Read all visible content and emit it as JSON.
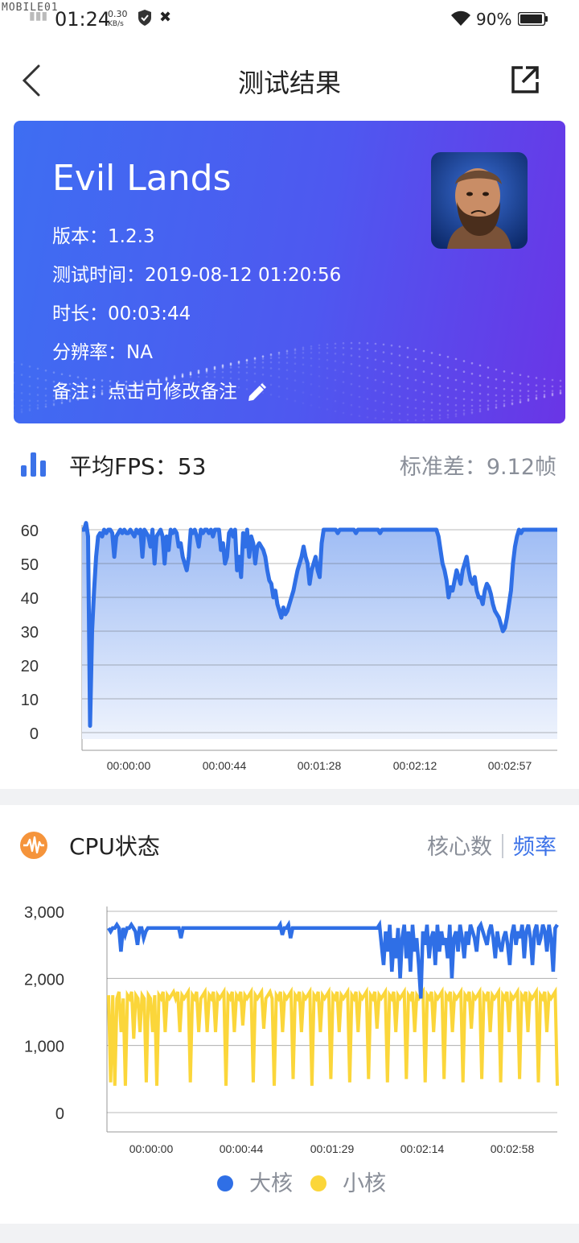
{
  "status_bar": {
    "watermark": "MOBILE01",
    "time": "01:24",
    "net_speed_value": "0.30",
    "net_speed_unit": "KB/s",
    "battery_percent": "90%"
  },
  "header": {
    "title": "测试结果"
  },
  "game": {
    "name": "Evil Lands",
    "version_label": "版本：",
    "version": "1.2.3",
    "test_time_label": "测试时间：",
    "test_time": "2019-08-12 01:20:56",
    "duration_label": "时长：",
    "duration": "00:03:44",
    "resolution_label": "分辨率：",
    "resolution": "NA",
    "remark_label": "备注：",
    "remark": "点击可修改备注"
  },
  "fps": {
    "label": "平均FPS：",
    "value": "53",
    "std_label": "标准差：",
    "std_value": "9.12帧"
  },
  "cpu": {
    "label": "CPU状态",
    "toggle_cores": "核心数",
    "toggle_freq": "频率",
    "legend_big": "大核",
    "legend_little": "小核"
  },
  "colors": {
    "accent": "#3b72e8",
    "big_core": "#2f6fe6",
    "little_core": "#fbd63a",
    "cpu_icon": "#f5943b"
  },
  "chart_data": [
    {
      "type": "area",
      "ylim": [
        0,
        60
      ],
      "yticks": [
        60,
        50,
        40,
        30,
        20,
        10,
        0
      ],
      "xticks": [
        "00:00:00",
        "00:00:44",
        "00:01:28",
        "00:02:12",
        "00:02:57"
      ],
      "grid": true,
      "x": [
        0,
        1,
        2,
        3,
        4,
        5,
        6,
        7,
        8,
        9,
        10,
        11,
        12,
        13,
        14,
        15,
        16,
        17,
        18,
        19,
        20,
        21,
        22,
        23,
        24,
        25,
        26,
        27,
        28,
        29,
        30,
        31,
        32,
        33,
        34,
        35,
        36,
        37,
        38,
        39,
        40,
        41,
        42,
        43,
        44,
        45,
        46,
        47,
        48,
        49,
        50,
        51,
        52,
        53,
        54,
        55,
        56,
        57,
        58,
        59,
        60,
        61,
        62,
        63,
        64,
        65,
        66,
        67,
        68,
        69,
        70,
        71,
        72,
        73,
        74,
        75,
        76,
        77,
        78,
        79,
        80,
        81,
        82,
        83,
        84,
        85,
        86,
        87,
        88,
        89,
        90,
        91,
        92,
        93,
        94,
        95,
        96,
        97,
        98,
        99,
        100,
        101,
        102,
        103,
        104,
        105,
        106,
        107,
        108,
        109,
        110,
        111,
        112,
        113,
        114,
        115,
        116,
        117,
        118,
        119,
        120,
        121,
        122,
        123,
        124,
        125,
        126,
        127,
        128,
        129,
        130,
        131,
        132,
        133,
        134,
        135,
        136,
        137,
        138,
        139,
        140,
        141,
        142,
        143,
        144,
        145,
        146,
        147,
        148,
        149,
        150,
        151,
        152,
        153,
        154,
        155,
        156,
        157,
        158,
        159,
        160,
        161,
        162,
        163,
        164,
        165,
        166,
        167,
        168,
        169,
        170,
        171,
        172,
        173,
        174,
        175,
        176,
        177,
        178,
        179,
        180,
        181,
        182,
        183,
        184,
        185,
        186,
        187,
        188,
        189,
        190,
        191,
        192,
        193,
        194,
        195,
        196,
        197,
        198,
        199,
        200,
        201,
        202,
        203,
        204,
        205,
        206,
        207,
        208,
        209,
        210,
        211,
        212,
        213,
        214,
        215,
        216,
        217,
        218,
        219,
        220,
        221,
        222,
        223,
        224
      ],
      "values": [
        60,
        60,
        62,
        58,
        2,
        30,
        42,
        52,
        58,
        59,
        58,
        60,
        59,
        60,
        60,
        59,
        52,
        58,
        59,
        60,
        59,
        60,
        59,
        59,
        60,
        59,
        58,
        60,
        59,
        60,
        52,
        60,
        59,
        58,
        55,
        60,
        50,
        58,
        59,
        60,
        58,
        50,
        58,
        54,
        60,
        59,
        60,
        59,
        55,
        56,
        52,
        50,
        48,
        52,
        60,
        59,
        60,
        58,
        55,
        60,
        59,
        60,
        60,
        59,
        60,
        58,
        60,
        60,
        60,
        54,
        56,
        50,
        52,
        59,
        60,
        58,
        60,
        48,
        52,
        46,
        59,
        55,
        60,
        52,
        58,
        56,
        50,
        55,
        56,
        55,
        54,
        52,
        48,
        45,
        44,
        40,
        42,
        38,
        36,
        34,
        37,
        35,
        36,
        38,
        40,
        42,
        45,
        48,
        50,
        52,
        55,
        52,
        50,
        44,
        48,
        50,
        52,
        48,
        46,
        56,
        60,
        60,
        60,
        60,
        60,
        60,
        60,
        59,
        60,
        60,
        60,
        60,
        60,
        60,
        60,
        60,
        59,
        60,
        60,
        60,
        60,
        60,
        60,
        60,
        60,
        60,
        60,
        60,
        59,
        60,
        60,
        60,
        60,
        60,
        60,
        60,
        60,
        60,
        60,
        60,
        60,
        60,
        60,
        60,
        60,
        60,
        60,
        60,
        60,
        60,
        60,
        60,
        60,
        60,
        60,
        60,
        60,
        58,
        54,
        50,
        48,
        45,
        40,
        43,
        42,
        45,
        48,
        46,
        44,
        48,
        50,
        52,
        48,
        45,
        44,
        46,
        42,
        40,
        40,
        38,
        42,
        44,
        43,
        41,
        38,
        36,
        35,
        34,
        32,
        30,
        31,
        34,
        38,
        42,
        50,
        55,
        58,
        60,
        59,
        60,
        60,
        60,
        60,
        60,
        60,
        60,
        60,
        60,
        60,
        60,
        60,
        60,
        60,
        60,
        60,
        60,
        60
      ]
    },
    {
      "type": "line",
      "ylim": [
        0,
        3000
      ],
      "yticks": [
        "3,000",
        "2,000",
        "1,000",
        "0"
      ],
      "xticks": [
        "00:00:00",
        "00:00:44",
        "00:01:29",
        "00:02:14",
        "00:02:58"
      ],
      "grid": true,
      "legend": "bottom-center",
      "series": [
        {
          "name": "大核",
          "values": [
            2750,
            2700,
            2750,
            2750,
            2800,
            2750,
            2400,
            2750,
            2650,
            2750,
            2750,
            2800,
            2750,
            2700,
            2500,
            2750,
            2750,
            2600,
            2700,
            2750,
            2750,
            2750,
            2750,
            2750,
            2750,
            2750,
            2750,
            2750,
            2750,
            2750,
            2750,
            2750,
            2750,
            2750,
            2750,
            2600,
            2750,
            2750,
            2750,
            2750,
            2750,
            2750,
            2750,
            2750,
            2750,
            2750,
            2750,
            2750,
            2750,
            2750,
            2750,
            2750,
            2750,
            2750,
            2750,
            2750,
            2750,
            2750,
            2750,
            2750,
            2750,
            2750,
            2750,
            2750,
            2750,
            2750,
            2750,
            2750,
            2750,
            2750,
            2750,
            2750,
            2750,
            2750,
            2750,
            2750,
            2750,
            2750,
            2750,
            2750,
            2750,
            2750,
            2750,
            2800,
            2650,
            2750,
            2750,
            2800,
            2600,
            2750,
            2750,
            2750,
            2750,
            2750,
            2750,
            2750,
            2750,
            2750,
            2750,
            2750,
            2750,
            2750,
            2750,
            2750,
            2750,
            2750,
            2750,
            2750,
            2750,
            2750,
            2750,
            2750,
            2750,
            2750,
            2750,
            2750,
            2750,
            2750,
            2750,
            2750,
            2750,
            2750,
            2750,
            2750,
            2750,
            2750,
            2750,
            2750,
            2750,
            2750,
            2750,
            2800,
            2500,
            2200,
            2700,
            2400,
            2800,
            2100,
            2600,
            2300,
            2750,
            2000,
            2600,
            2800,
            2300,
            2700,
            2100,
            2800,
            2400,
            2600,
            2200,
            1700,
            2700,
            2500,
            2800,
            2300,
            2600,
            2700,
            2200,
            2800,
            2400,
            2700,
            2500,
            2600,
            2300,
            2800,
            2000,
            2600,
            2700,
            2400,
            2800,
            2600,
            2300,
            2700,
            2500,
            2800,
            2700,
            2600,
            2400,
            2750,
            2800,
            2700,
            2600,
            2500,
            2700,
            2800,
            2600,
            2300,
            2700,
            2500,
            2400,
            2600,
            2700,
            2500,
            2200,
            2650,
            2800,
            2500,
            2700,
            2600,
            2800,
            2300,
            2700,
            2800,
            2600,
            2200,
            2700,
            2800,
            2500,
            2600,
            2800,
            2700,
            2400,
            2800,
            2600,
            2100,
            2750,
            2800
          ]
        },
        {
          "name": "小核",
          "values": [
            1750,
            450,
            1750,
            400,
            1700,
            1800,
            1200,
            1700,
            400,
            1750,
            1700,
            1800,
            1100,
            1750,
            1700,
            1200,
            1750,
            1700,
            450,
            1750,
            1700,
            1200,
            1750,
            400,
            1750,
            1700,
            1800,
            1200,
            1750,
            1700,
            1750,
            1800,
            1700,
            1800,
            1200,
            1750,
            1700,
            1750,
            1800,
            450,
            1750,
            1700,
            1800,
            1200,
            1700,
            1750,
            1800,
            1200,
            1750,
            1700,
            1800,
            1200,
            1750,
            1700,
            1750,
            1800,
            400,
            1750,
            1700,
            1800,
            1200,
            1750,
            1700,
            1800,
            1300,
            1750,
            1700,
            1750,
            1800,
            450,
            1750,
            1700,
            1750,
            1800,
            1250,
            1700,
            1750,
            1800,
            1700,
            400,
            1750,
            1700,
            1800,
            1200,
            1750,
            1700,
            1750,
            1800,
            500,
            1750,
            1700,
            1800,
            1200,
            1750,
            1700,
            1750,
            1800,
            400,
            1750,
            1700,
            1800,
            1200,
            1750,
            1700,
            1750,
            1800,
            500,
            1750,
            1700,
            1800,
            1200,
            1750,
            1700,
            1750,
            1800,
            450,
            1750,
            1700,
            1800,
            1200,
            1750,
            1700,
            1750,
            1800,
            500,
            1750,
            1700,
            1800,
            1250,
            1750,
            1700,
            1750,
            1800,
            450,
            1750,
            1700,
            1800,
            1200,
            1750,
            1700,
            1750,
            1800,
            500,
            1750,
            1700,
            1800,
            1200,
            1750,
            1700,
            1750,
            1800,
            450,
            1750,
            1700,
            1800,
            1200,
            1750,
            1700,
            1750,
            1800,
            500,
            1750,
            1700,
            1800,
            1200,
            1750,
            1700,
            1750,
            1800,
            450,
            1750,
            1700,
            1800,
            1250,
            1750,
            1700,
            1750,
            1800,
            500,
            1750,
            1700,
            1800,
            1200,
            1750,
            1700,
            1750,
            1800,
            450,
            1750,
            1700,
            1800,
            1200,
            1750,
            1700,
            1750,
            1800,
            500,
            1750,
            1700,
            1800,
            1200,
            1750,
            1700,
            1750,
            1800,
            450,
            1750,
            1700,
            1800,
            1200,
            1750,
            1700,
            1750,
            1800,
            400
          ]
        }
      ]
    }
  ]
}
